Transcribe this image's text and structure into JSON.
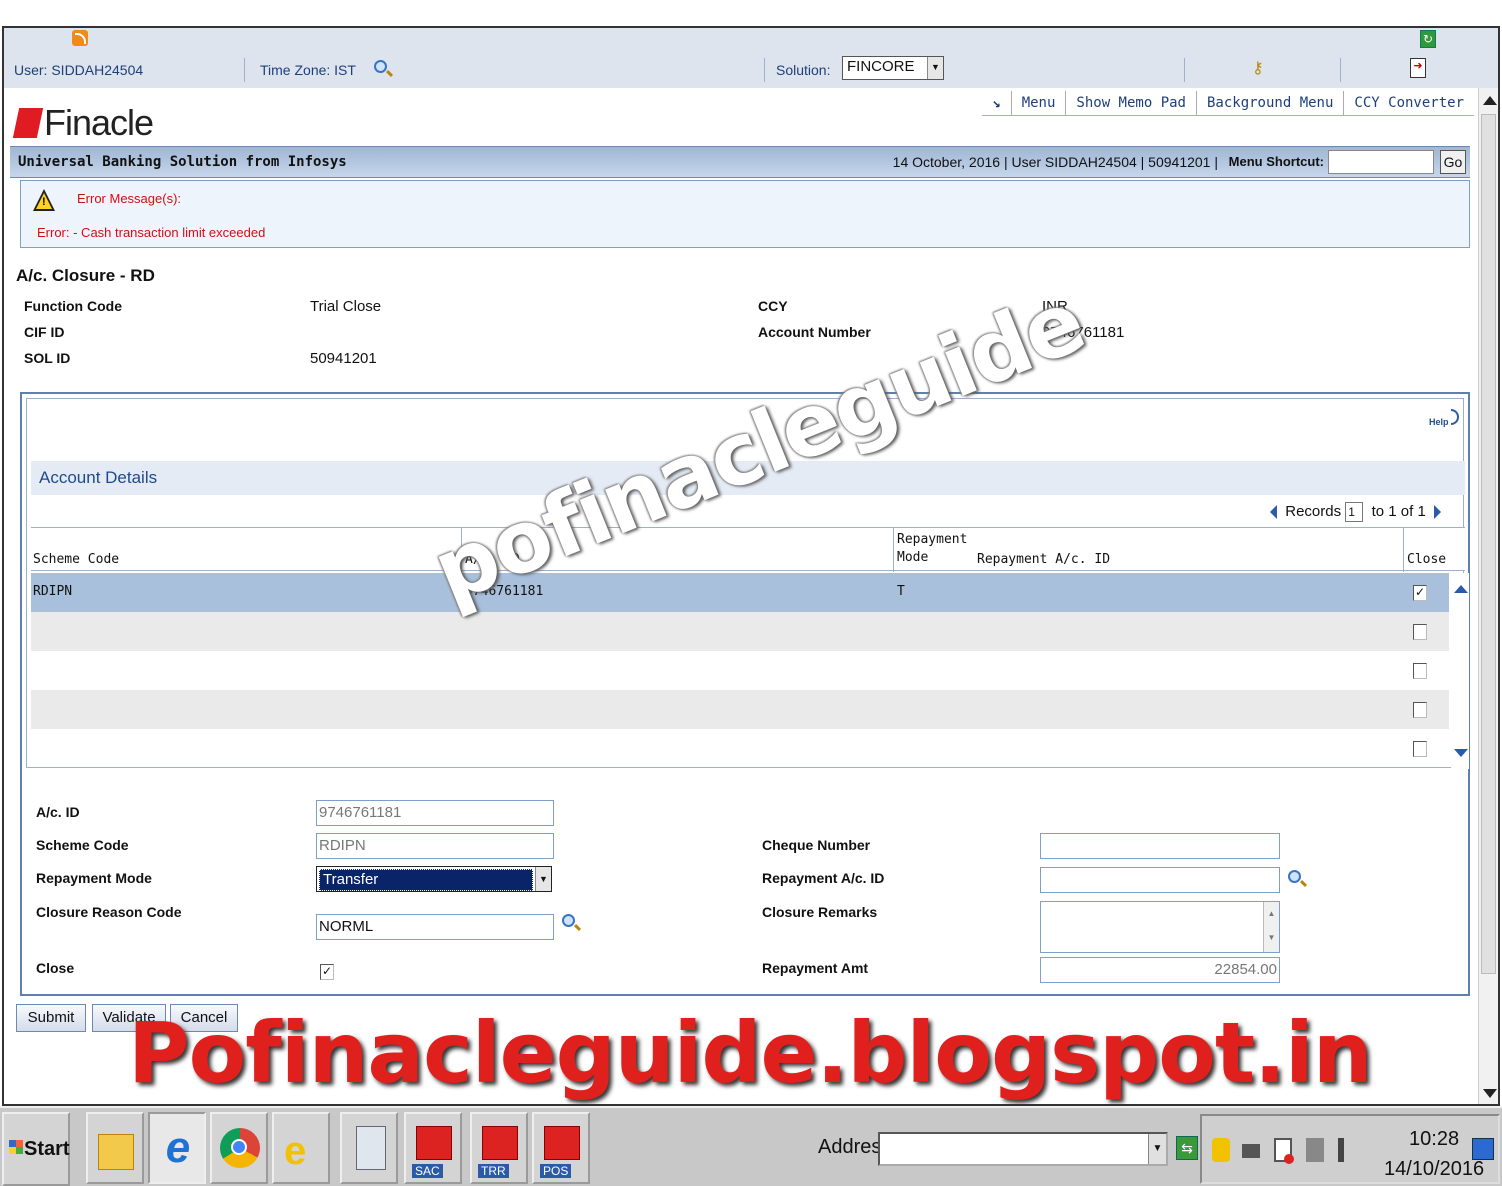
{
  "topbar": {
    "user": "User: SIDDAH24504",
    "timezone": "Time Zone: IST",
    "solution_label": "Solution:",
    "solution_value": "FINCORE"
  },
  "brand": {
    "logo_text": "Finacle",
    "tagline": "Universal Banking Solution from Infosys"
  },
  "nav": [
    "Menu",
    "Show Memo Pad",
    "Background Menu",
    "CCY Converter"
  ],
  "status": {
    "info": "14 October, 2016  |  User  SIDDAH24504  |  50941201  |",
    "menu_shortcut_label": "Menu Shortcut:",
    "go": "Go"
  },
  "error": {
    "title": "Error Message(s):",
    "message": "Error: - Cash transaction limit exceeded"
  },
  "page": {
    "title": "A/c. Closure - RD",
    "function_code_label": "Function Code",
    "function_code_value": "Trial Close",
    "cif_label": "CIF ID",
    "cif_value": "",
    "sol_label": "SOL ID",
    "sol_value": "50941201",
    "ccy_label": "CCY",
    "ccy_value": "INR",
    "account_label": "Account Number",
    "account_value": "9746761181"
  },
  "details": {
    "section_title": "Account Details",
    "help": "Help",
    "records_label": "Records",
    "records_from": "1",
    "records_to": "to  1  of  1",
    "columns": [
      "Scheme Code",
      "A/c. ID",
      "Repayment Mode",
      "Repayment A/c. ID",
      "Close"
    ],
    "rows": [
      {
        "scheme": "RDIPN",
        "acid": "9746761181",
        "mode": "T",
        "close": true
      },
      {
        "scheme": "",
        "acid": "",
        "mode": "",
        "close": false
      },
      {
        "scheme": "",
        "acid": "",
        "mode": "",
        "close": false
      },
      {
        "scheme": "",
        "acid": "",
        "mode": "",
        "close": false
      },
      {
        "scheme": "",
        "acid": "",
        "mode": "",
        "close": false
      }
    ]
  },
  "form": {
    "acid_label": "A/c. ID",
    "acid_value": "9746761181",
    "scheme_label": "Scheme Code",
    "scheme_value": "RDIPN",
    "repay_mode_label": "Repayment Mode",
    "repay_mode_value": "Transfer",
    "closure_reason_label": "Closure Reason Code",
    "closure_reason_value": "NORML",
    "close_label": "Close",
    "close_checked": true,
    "cheque_label": "Cheque Number",
    "cheque_value": "",
    "repay_acid_label": "Repayment A/c. ID",
    "repay_acid_value": "",
    "closure_remarks_label": "Closure Remarks",
    "closure_remarks_value": "",
    "repay_amt_label": "Repayment Amt",
    "repay_amt_value": "22854.00"
  },
  "buttons": {
    "submit": "Submit",
    "validate": "Validate",
    "cancel": "Cancel"
  },
  "watermark": {
    "diagonal": "pofinacleguide",
    "banner": "Pofinacleguide.blogspot.in"
  },
  "taskbar": {
    "start": "Start",
    "address_label": "Address",
    "apps": [
      "SAC",
      "TRR",
      "POS"
    ],
    "time": "10:28",
    "date": "14/10/2016"
  }
}
